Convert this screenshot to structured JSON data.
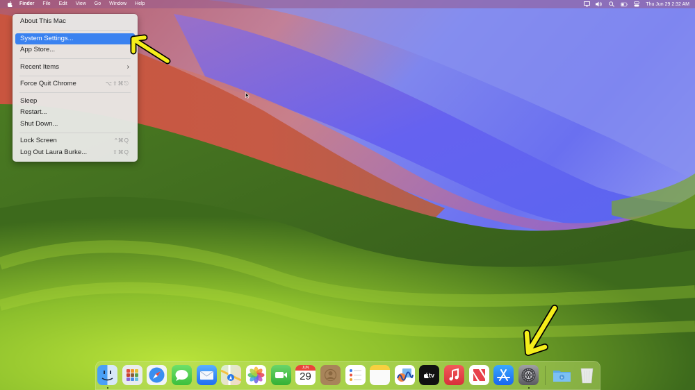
{
  "menubar": {
    "apple_icon": "apple-logo-icon",
    "items": [
      "Finder",
      "File",
      "Edit",
      "View",
      "Go",
      "Window",
      "Help"
    ],
    "status_icons": [
      "screen-mirroring-icon",
      "volume-icon",
      "spotlight-search-icon",
      "battery-icon",
      "control-center-icon"
    ],
    "clock": "Thu Jun 29  2:32 AM"
  },
  "apple_menu": {
    "items": [
      {
        "label": "About This Mac",
        "shortcut": ""
      },
      {
        "label": "System Settings...",
        "shortcut": "",
        "highlighted": true
      },
      {
        "label": "App Store...",
        "shortcut": ""
      },
      {
        "label": "Recent Items",
        "shortcut": "",
        "submenu": true
      },
      {
        "label": "Force Quit Chrome",
        "shortcut": "⌥⇧⌘⎋"
      },
      {
        "label": "Sleep",
        "shortcut": ""
      },
      {
        "label": "Restart...",
        "shortcut": ""
      },
      {
        "label": "Shut Down...",
        "shortcut": ""
      },
      {
        "label": "Lock Screen",
        "shortcut": "^⌘Q"
      },
      {
        "label": "Log Out Laura Burke...",
        "shortcut": "⇧⌘Q"
      }
    ],
    "submenu_glyph": "›"
  },
  "dock": {
    "apps": [
      {
        "name": "Finder",
        "icon": "finder-icon",
        "running": true
      },
      {
        "name": "Launchpad",
        "icon": "launchpad-icon"
      },
      {
        "name": "Safari",
        "icon": "safari-icon"
      },
      {
        "name": "Messages",
        "icon": "messages-icon"
      },
      {
        "name": "Mail",
        "icon": "mail-icon"
      },
      {
        "name": "Maps",
        "icon": "maps-icon"
      },
      {
        "name": "Photos",
        "icon": "photos-icon"
      },
      {
        "name": "FaceTime",
        "icon": "facetime-icon"
      },
      {
        "name": "Calendar",
        "icon": "calendar-icon",
        "month": "JUN",
        "day": "29"
      },
      {
        "name": "Contacts",
        "icon": "contacts-icon"
      },
      {
        "name": "Reminders",
        "icon": "reminders-icon"
      },
      {
        "name": "Notes",
        "icon": "notes-icon"
      },
      {
        "name": "Freeform",
        "icon": "freeform-icon"
      },
      {
        "name": "Apple TV",
        "icon": "apple-tv-icon",
        "label": "tv"
      },
      {
        "name": "Music",
        "icon": "music-icon"
      },
      {
        "name": "News",
        "icon": "news-icon"
      },
      {
        "name": "App Store",
        "icon": "app-store-icon"
      },
      {
        "name": "System Settings",
        "icon": "system-settings-icon",
        "running": true
      },
      {
        "name": "Downloads",
        "icon": "downloads-folder-icon"
      },
      {
        "name": "Trash",
        "icon": "trash-icon"
      }
    ]
  },
  "annotations": {
    "arrow_color": "#f5ee1a",
    "targets": [
      "System Settings menu item",
      "System Settings dock icon"
    ]
  },
  "colors": {
    "menu_highlight": "#3a82f0",
    "wallpaper_blue": "#6a6cf0",
    "wallpaper_red": "#cc5a45",
    "wallpaper_green": "#8cc030"
  }
}
